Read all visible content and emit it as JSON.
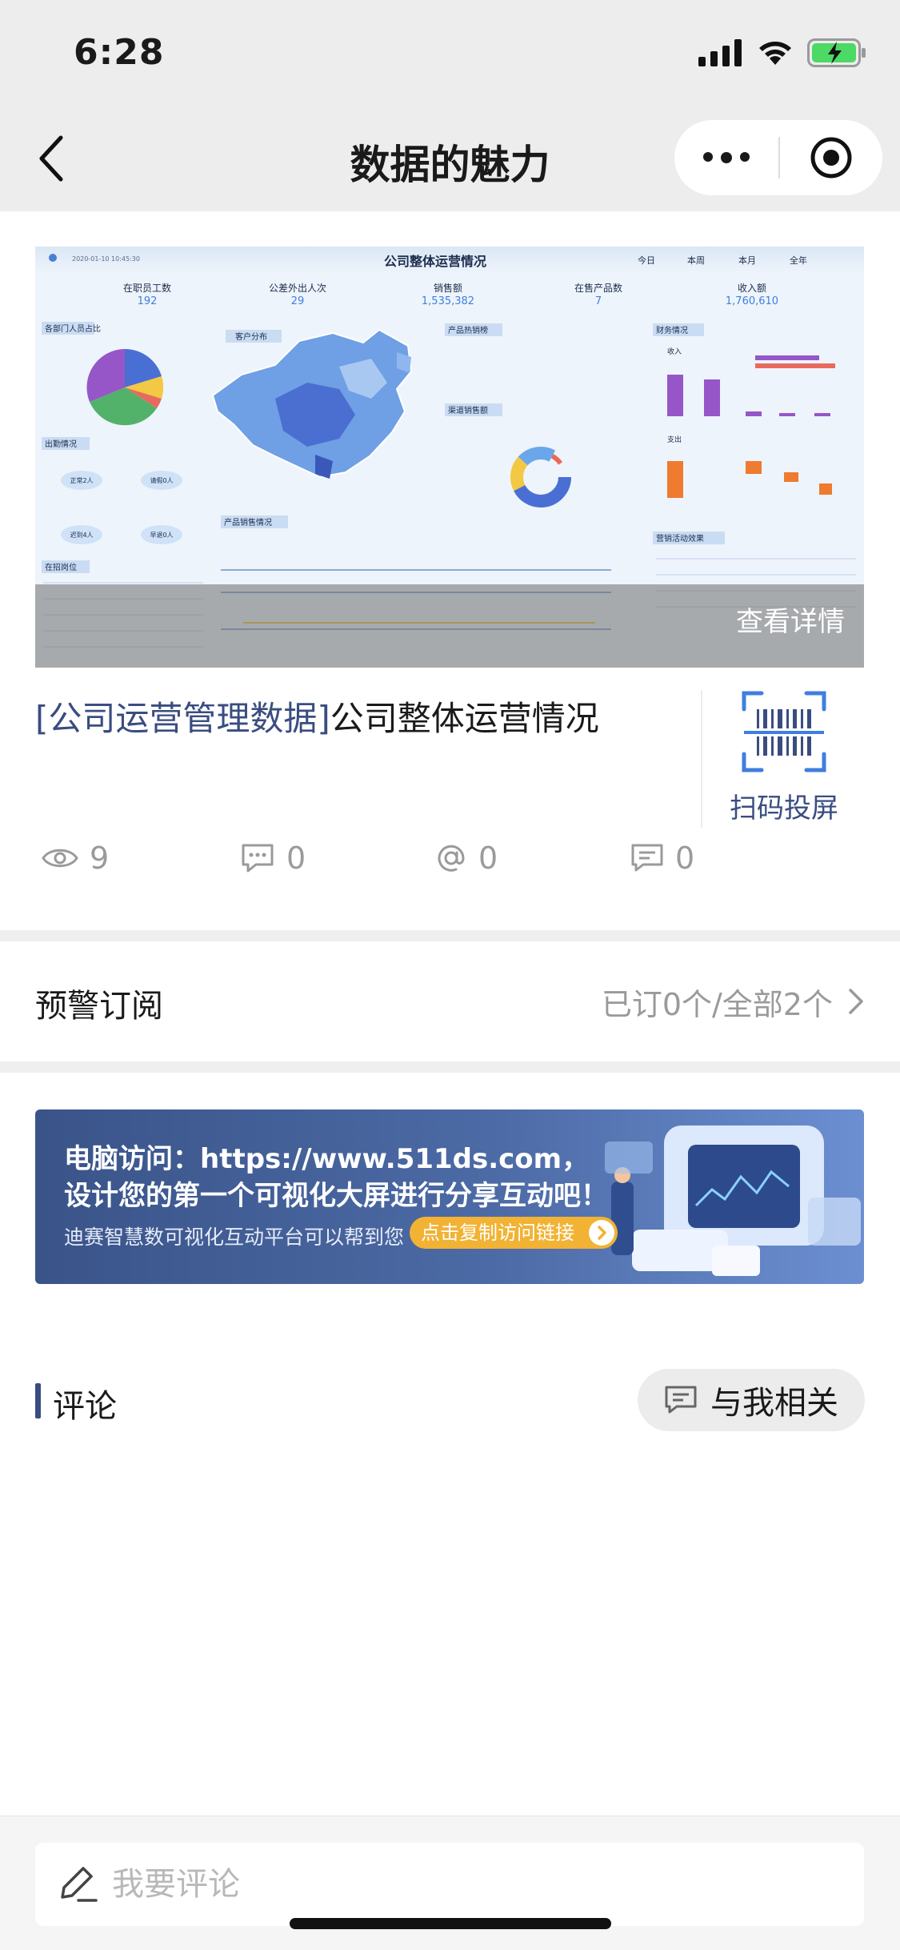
{
  "status_bar": {
    "time": "6:28",
    "icons": [
      "signal-icon",
      "wifi-icon",
      "battery-charging-icon"
    ]
  },
  "nav": {
    "title": "数据的魅力",
    "icons": [
      "back-icon",
      "more-icon",
      "record-icon"
    ]
  },
  "dashboard": {
    "title": "公司整体运营情况",
    "date": "2020-01-10 10:45:30",
    "tabs": [
      "今日",
      "本周",
      "本月",
      "全年"
    ],
    "kpis": [
      {
        "label": "在职员工数",
        "value": "192"
      },
      {
        "label": "公差外出人次",
        "value": "29"
      },
      {
        "label": "销售额",
        "value": "1,535,382"
      },
      {
        "label": "在售产品数",
        "value": "7"
      },
      {
        "label": "收入额",
        "value": "1,760,610"
      }
    ],
    "panels": [
      "各部门人员占比",
      "客户分布",
      "产品热销榜",
      "渠道销售额",
      "财务情况",
      "出勤情况",
      "产品销售情况",
      "在招岗位",
      "营销活动效果"
    ],
    "attendance": [
      "正常2人",
      "请假0人",
      "迟到4人",
      "早退0人"
    ],
    "finance_labels": [
      "收入",
      "支出"
    ],
    "detail_link": "查看详情"
  },
  "item": {
    "tag": "[公司运营管理数据]",
    "title": "公司整体运营情况",
    "scan_label": "扫码投屏",
    "stats": [
      {
        "icon": "eye-icon",
        "value": "9"
      },
      {
        "icon": "comment-icon",
        "value": "0"
      },
      {
        "icon": "at-icon",
        "value": "0"
      },
      {
        "icon": "message-icon",
        "value": "0"
      }
    ]
  },
  "alert": {
    "label": "预警订阅",
    "value": "已订0个/全部2个"
  },
  "banner": {
    "line1": "电脑访问：https://www.511ds.com，",
    "line2": "设计您的第一个可视化大屏进行分享互动吧！",
    "line3": "迪赛智慧数可视化互动平台可以帮到您",
    "button": "点击复制访问链接"
  },
  "comments": {
    "label": "评论",
    "filter": "与我相关"
  },
  "input": {
    "placeholder": "我要评论"
  },
  "colors": {
    "accent": "#3a4d80",
    "banner_bg": "#4c6aa5",
    "button": "#f2b233"
  }
}
